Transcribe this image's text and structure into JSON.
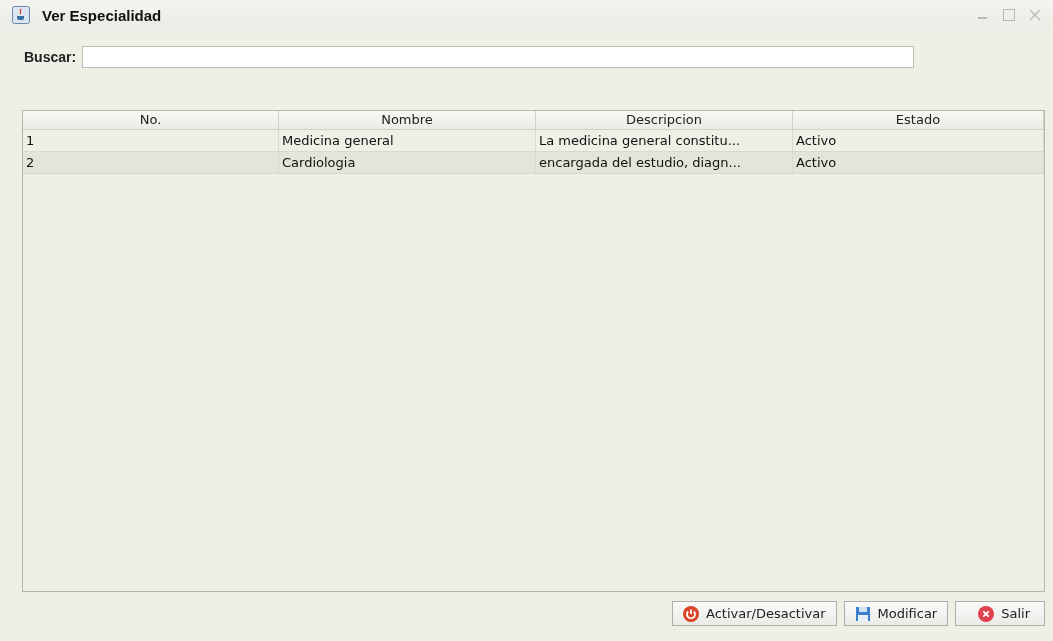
{
  "window": {
    "title": "Ver Especialidad"
  },
  "search": {
    "label": "Buscar:"
  },
  "table": {
    "columns": [
      "No.",
      "Nombre",
      "Descripcion",
      "Estado"
    ],
    "rows": [
      [
        "1",
        "Medicina general",
        "La medicina general constitu...",
        "Activo"
      ],
      [
        "2",
        "Cardiologia",
        "encargada del estudio, diagn...",
        "Activo"
      ]
    ]
  },
  "buttons": [
    {
      "kind": "power",
      "label": "Activar/Desactivar"
    },
    {
      "kind": "save",
      "label": "Modificar"
    },
    {
      "kind": "exit",
      "label": "Salir"
    }
  ]
}
